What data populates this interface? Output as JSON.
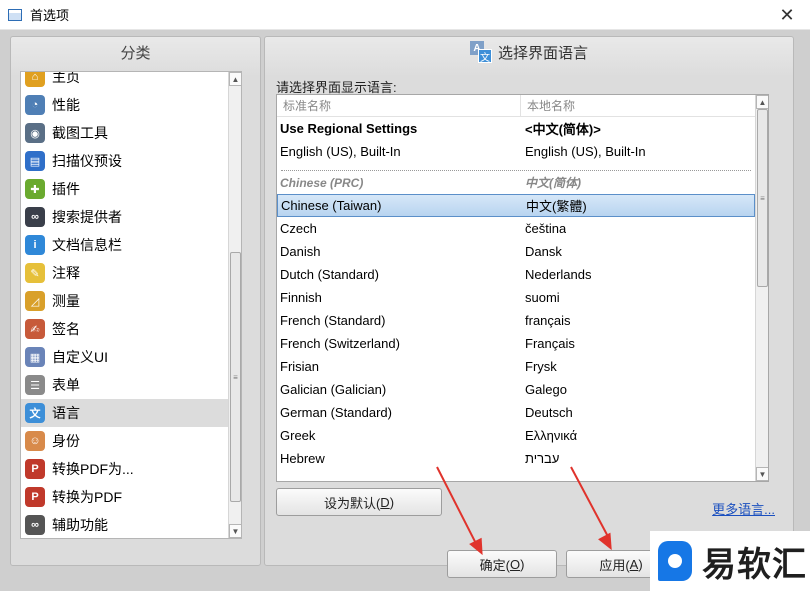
{
  "window": {
    "title": "首选项",
    "close_glyph": "✕"
  },
  "left": {
    "header": "分类",
    "items": [
      {
        "label": "主页",
        "icon": "home-icon",
        "color": "#e0a020",
        "glyph": "⌂"
      },
      {
        "label": "性能",
        "icon": "gauge-icon",
        "color": "#4f7fb5",
        "glyph": "◔"
      },
      {
        "label": "截图工具",
        "icon": "camera-icon",
        "color": "#5a6f86",
        "glyph": "◉"
      },
      {
        "label": "扫描仪预设",
        "icon": "scanner-icon",
        "color": "#2f6fc9",
        "glyph": "▤"
      },
      {
        "label": "插件",
        "icon": "puzzle-icon",
        "color": "#6aaa2f",
        "glyph": "✚"
      },
      {
        "label": "搜索提供者",
        "icon": "binoculars-icon",
        "color": "#3a3f4a",
        "glyph": "∞"
      },
      {
        "label": "文档信息栏",
        "icon": "info-icon",
        "color": "#2f88d8",
        "glyph": "i"
      },
      {
        "label": "注释",
        "icon": "note-icon",
        "color": "#e6c03a",
        "glyph": "✎"
      },
      {
        "label": "测量",
        "icon": "ruler-icon",
        "color": "#d9a02a",
        "glyph": "◿"
      },
      {
        "label": "签名",
        "icon": "signature-icon",
        "color": "#c75a3a",
        "glyph": "✍"
      },
      {
        "label": "自定义UI",
        "icon": "customize-icon",
        "color": "#6a84b8",
        "glyph": "▦"
      },
      {
        "label": "表单",
        "icon": "form-icon",
        "color": "#8a8a8a",
        "glyph": "☰"
      },
      {
        "label": "语言",
        "icon": "language-icon",
        "color": "#3d8fd8",
        "glyph": "文"
      },
      {
        "label": "身份",
        "icon": "identity-icon",
        "color": "#d88a4a",
        "glyph": "☺"
      },
      {
        "label": "转换PDF为...",
        "icon": "pdf-convert-from-icon",
        "color": "#c0392b",
        "glyph": "P"
      },
      {
        "label": "转换为PDF",
        "icon": "pdf-convert-to-icon",
        "color": "#c0392b",
        "glyph": "P"
      },
      {
        "label": "辅助功能",
        "icon": "glasses-icon",
        "color": "#555555",
        "glyph": "∞"
      }
    ],
    "selected_index": 12
  },
  "right": {
    "header": "选择界面语言",
    "prompt": "请选择界面显示语言:",
    "columns": [
      "标准名称",
      "本地名称"
    ],
    "rows": [
      {
        "std": "Use Regional Settings",
        "local": "<中文(简体)>",
        "style": "bold"
      },
      {
        "std": "English (US), Built-In",
        "local": "English (US), Built-In",
        "style": "normal"
      },
      {
        "std": "Chinese (PRC)",
        "local": "中文(简体)",
        "style": "group"
      },
      {
        "std": "Chinese (Taiwan)",
        "local": "中文(繁體)",
        "style": "selected"
      },
      {
        "std": "Czech",
        "local": "čeština",
        "style": "normal"
      },
      {
        "std": "Danish",
        "local": "Dansk",
        "style": "normal"
      },
      {
        "std": "Dutch (Standard)",
        "local": "Nederlands",
        "style": "normal"
      },
      {
        "std": "Finnish",
        "local": "suomi",
        "style": "normal"
      },
      {
        "std": "French (Standard)",
        "local": "français",
        "style": "normal"
      },
      {
        "std": "French (Switzerland)",
        "local": "Français",
        "style": "normal"
      },
      {
        "std": "Frisian",
        "local": "Frysk",
        "style": "normal"
      },
      {
        "std": "Galician (Galician)",
        "local": "Galego",
        "style": "normal"
      },
      {
        "std": "German (Standard)",
        "local": "Deutsch",
        "style": "normal"
      },
      {
        "std": "Greek",
        "local": "Ελληνικά",
        "style": "normal"
      },
      {
        "std": "Hebrew",
        "local": "עברית",
        "style": "normal"
      }
    ],
    "set_default": {
      "label": "设为默认(",
      "key": "D",
      "suffix": ")"
    },
    "more_link": "更多语言..."
  },
  "footer": {
    "ok": {
      "label": "确定(",
      "key": "O",
      "suffix": ")"
    },
    "apply": {
      "label": "应用(",
      "key": "A",
      "suffix": ")"
    }
  },
  "watermark": {
    "text": "易软汇"
  },
  "colors": {
    "selection": "#b8d4f0",
    "annotation_arrow": "#e0332c",
    "link": "#1a4fbf"
  }
}
